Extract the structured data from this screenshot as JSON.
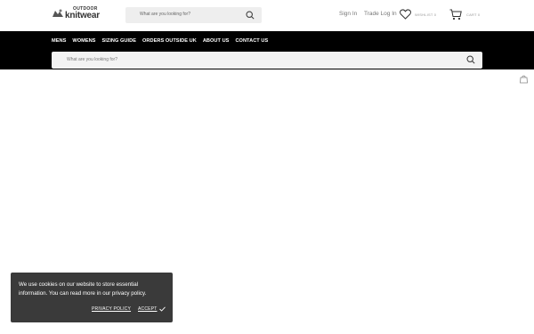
{
  "header": {
    "logo_top": "OUTDOOR",
    "logo_main": "knitwear",
    "search_placeholder": "What are you looking for?",
    "sign_in": "Sign In",
    "trade_login": "Trade Log In",
    "wishlist": "WISHLIST 0",
    "cart": "CART 0"
  },
  "nav": {
    "items": [
      "MENS",
      "WOMENS",
      "SIZING GUIDE",
      "ORDERS OUTSIDE UK",
      "ABOUT US",
      "CONTACT US"
    ],
    "search_placeholder": "What are you looking for?"
  },
  "cookie": {
    "message": "We use cookies on our website to store essential information. You can read more in our privacy policy.",
    "privacy_policy": "PRIVACY POLICY",
    "accept": "ACCEPT"
  },
  "icons": {
    "search": "search-icon",
    "wishlist": "heart-icon",
    "cart": "cart-icon",
    "side": "bag-icon",
    "accept": "checkmark-icon"
  },
  "colors": {
    "nav_background": "#000000",
    "cookie_background": "#3a3a3a",
    "search_background": "#eeeeee"
  }
}
